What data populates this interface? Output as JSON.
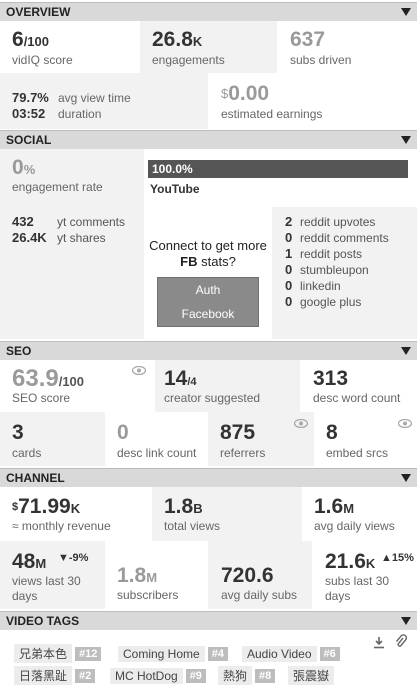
{
  "overview": {
    "title": "OVERVIEW",
    "vidiq_score": {
      "value": "6",
      "suffix": "/100",
      "label": "vidIQ score"
    },
    "engagements": {
      "value": "26.8",
      "suffix": "K",
      "label": "engagements"
    },
    "subs_driven": {
      "value": "637",
      "label": "subs driven"
    },
    "avg_view_time": {
      "value": "79.7%",
      "label": "avg view time"
    },
    "duration": {
      "value": "03:52",
      "label": "duration"
    },
    "earnings": {
      "prefix": "$",
      "value": "0.00",
      "label": "estimated earnings"
    }
  },
  "social": {
    "title": "SOCIAL",
    "engagement_rate": {
      "value": "0",
      "suffix": "%",
      "label": "engagement rate"
    },
    "youtube_bar": {
      "percent_text": "100.0%",
      "fill": 1.0,
      "label": "YouTube"
    },
    "yt_comments": {
      "value": "432",
      "label": "yt comments"
    },
    "yt_shares": {
      "value": "26.4K",
      "label": "yt shares"
    },
    "connect_text": "Connect to get more",
    "connect_fb": "FB",
    "connect_tail": "stats?",
    "auth_button": {
      "line1": "Auth",
      "line2": "Facebook"
    },
    "right_stats": [
      {
        "value": "2",
        "label": "reddit upvotes"
      },
      {
        "value": "0",
        "label": "reddit comments"
      },
      {
        "value": "1",
        "label": "reddit posts"
      },
      {
        "value": "0",
        "label": "stumbleupon"
      },
      {
        "value": "0",
        "label": "linkedin"
      },
      {
        "value": "0",
        "label": "google plus"
      }
    ]
  },
  "seo": {
    "title": "SEO",
    "seo_score": {
      "value": "63.9",
      "suffix": "/100",
      "label": "SEO score"
    },
    "creator_suggested": {
      "value": "14",
      "suffix": "/4",
      "label": "creator suggested"
    },
    "desc_word_count": {
      "value": "313",
      "label": "desc word count"
    },
    "cards": {
      "value": "3",
      "label": "cards"
    },
    "desc_link_count": {
      "value": "0",
      "label": "desc link count"
    },
    "referrers": {
      "value": "875",
      "label": "referrers"
    },
    "embed_srcs": {
      "value": "8",
      "label": "embed srcs"
    }
  },
  "channel": {
    "title": "CHANNEL",
    "monthly_revenue": {
      "prefix": "$",
      "value": "71.99",
      "suffix": "K",
      "label": "≈ monthly revenue"
    },
    "total_views": {
      "value": "1.8",
      "suffix": "B",
      "label": "total views"
    },
    "avg_daily_views": {
      "value": "1.6",
      "suffix": "M",
      "label": "avg daily views"
    },
    "views_last_30": {
      "value": "48",
      "suffix": "M",
      "change": "▼-9%",
      "label1": "views last 30",
      "label2": "days"
    },
    "subscribers": {
      "value": "1.8",
      "suffix": "M",
      "label": "subscribers"
    },
    "avg_daily_subs": {
      "value": "720.6",
      "label": "avg daily subs"
    },
    "subs_last_30": {
      "value": "21.6",
      "suffix": "K",
      "change": "▲15%",
      "label1": "subs last 30",
      "label2": "days"
    }
  },
  "video_tags": {
    "title": "VIDEO TAGS",
    "tags": [
      {
        "text": "兄弟本色",
        "count": "#12"
      },
      {
        "text": "Coming Home",
        "count": "#4"
      },
      {
        "text": "Audio Video",
        "count": "#6"
      },
      {
        "text": "日落黑趾",
        "count": "#2"
      },
      {
        "text": "MC HotDog",
        "count": "#9"
      },
      {
        "text": "熱狗",
        "count": "#8"
      },
      {
        "text": "張震嶽",
        "count": ""
      }
    ]
  }
}
